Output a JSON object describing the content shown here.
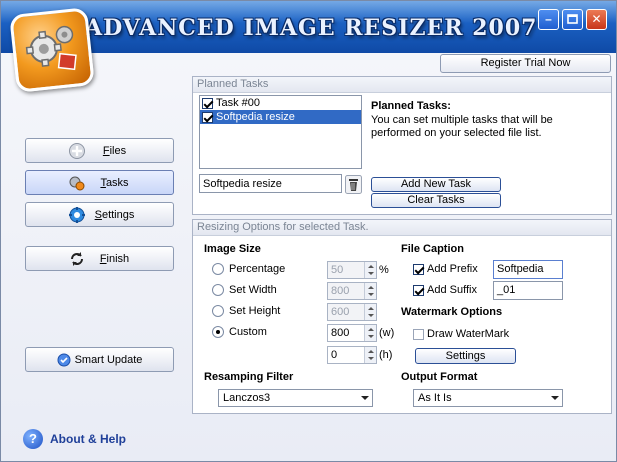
{
  "window": {
    "title": "ADVANCED IMAGE RESIZER 2007",
    "controls": {
      "minimize": "–",
      "close": "✕"
    },
    "colors": {
      "banner": "#1a5fc1",
      "selection": "#316ac5",
      "link": "#1f3f99"
    }
  },
  "nav": {
    "items": [
      {
        "label": "Files",
        "icon": "files-icon"
      },
      {
        "label": "Tasks",
        "icon": "tasks-icon"
      },
      {
        "label": "Settings",
        "icon": "settings-icon"
      },
      {
        "label": "Finish",
        "icon": "finish-icon"
      }
    ],
    "active": "Tasks",
    "smart_update": "Smart Update",
    "about": "About & Help",
    "about_icon_text": "?"
  },
  "register_label": "Register Trial Now",
  "planned": {
    "title": "Planned Tasks",
    "tasks": [
      {
        "label": "Task #00",
        "checked": true,
        "selected": false
      },
      {
        "label": "Softpedia resize",
        "checked": true,
        "selected": true
      }
    ],
    "info_title": "Planned Tasks:",
    "info_text": "You can set multiple tasks that will be performed on your selected file list.",
    "task_name_value": "Softpedia resize",
    "add_label": "Add New Task",
    "clear_label": "Clear Tasks"
  },
  "resizing": {
    "title": "Resizing Options for selected Task.",
    "image_size": {
      "heading": "Image Size",
      "options": [
        {
          "label": "Percentage",
          "value": "50",
          "unit": "%",
          "selected": false,
          "enabled": false
        },
        {
          "label": "Set Width",
          "value": "800",
          "unit": "",
          "selected": false,
          "enabled": false
        },
        {
          "label": "Set Height",
          "value": "600",
          "unit": "",
          "selected": false,
          "enabled": false
        },
        {
          "label": "Custom",
          "value": "800",
          "unit": "(w)",
          "selected": true,
          "enabled": true
        }
      ],
      "custom_height": "0",
      "custom_height_unit": "(h)"
    },
    "file_caption": {
      "heading": "File Caption",
      "prefix_label": "Add Prefix",
      "prefix_value": "Softpedia",
      "suffix_label": "Add Suffix",
      "suffix_value": "_01"
    },
    "watermark": {
      "heading": "Watermark Options",
      "draw_label": "Draw WaterMark",
      "settings_label": "Settings"
    },
    "resampling": {
      "heading": "Resamping Filter",
      "value": "Lanczos3"
    },
    "output": {
      "heading": "Output Format",
      "value": "As It Is"
    }
  }
}
